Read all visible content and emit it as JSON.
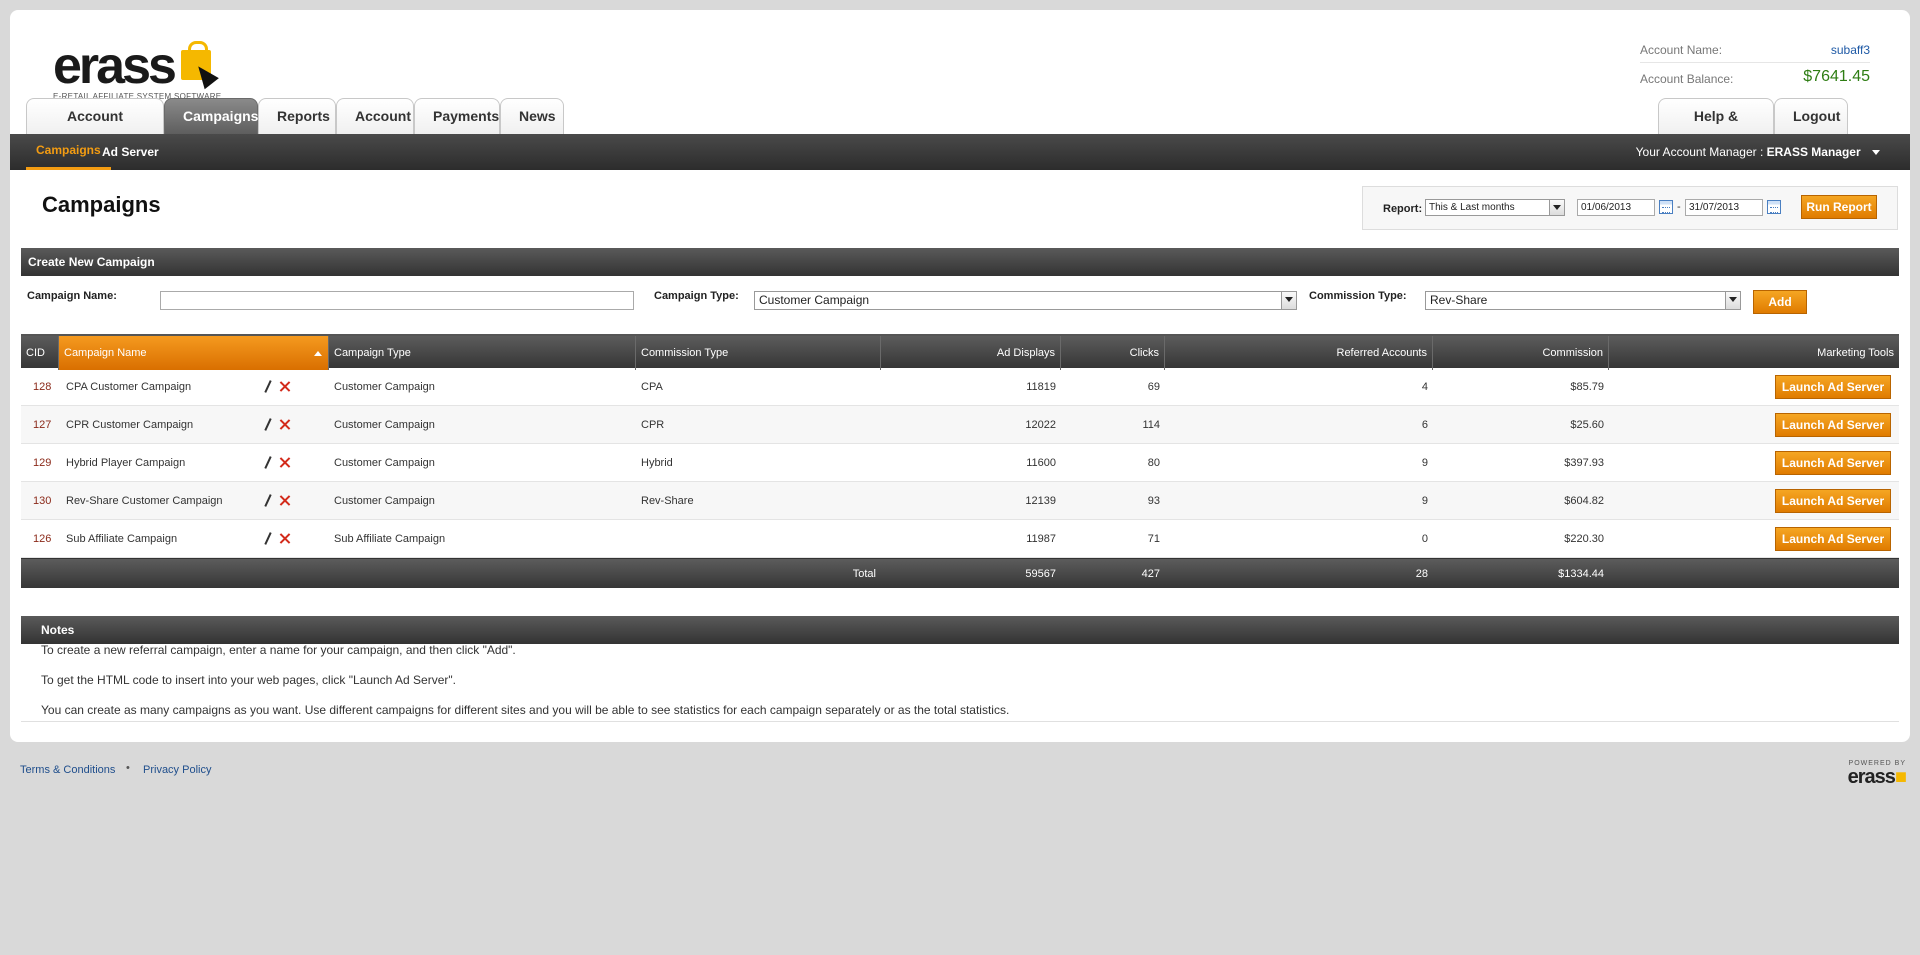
{
  "brand": {
    "logo_text": "erass",
    "tagline": "E-RETAIL AFFILIATE SYSTEM SOFTWARE"
  },
  "account": {
    "name_label": "Account Name:",
    "name_value": "subaff3",
    "balance_label": "Account Balance:",
    "balance_value": "$7641.45"
  },
  "tabs": [
    {
      "label": "Account Overview",
      "active": false
    },
    {
      "label": "Campaigns",
      "active": true
    },
    {
      "label": "Reports",
      "active": false
    },
    {
      "label": "Account",
      "active": false
    },
    {
      "label": "Payments",
      "active": false
    },
    {
      "label": "News",
      "active": false
    }
  ],
  "right_tabs": [
    {
      "label": "Help & Support"
    },
    {
      "label": "Logout"
    }
  ],
  "subnav": {
    "items": [
      {
        "label": "Campaigns",
        "active": true
      },
      {
        "label": "Ad Server",
        "active": false
      }
    ],
    "manager_label": "Your Account Manager :",
    "manager_name": "ERASS Manager"
  },
  "page_title": "Campaigns",
  "report": {
    "label": "Report:",
    "period": "This & Last months",
    "date_from": "01/06/2013",
    "separator": "-",
    "date_to": "31/07/2013",
    "run_label": "Run Report"
  },
  "create": {
    "header": "Create New Campaign",
    "name_label": "Campaign Name:",
    "name_value": "",
    "type_label": "Campaign Type:",
    "type_value": "Customer Campaign",
    "commission_label": "Commission Type:",
    "commission_value": "Rev-Share",
    "add_label": "Add"
  },
  "table": {
    "columns": [
      "CID",
      "Campaign Name",
      "Campaign Type",
      "Commission Type",
      "Ad Displays",
      "Clicks",
      "Referred Accounts",
      "Commission",
      "Marketing Tools"
    ],
    "rows": [
      {
        "cid": "128",
        "name": "CPA Customer Campaign",
        "type": "Customer Campaign",
        "commission_type": "CPA",
        "ad_displays": "11819",
        "clicks": "69",
        "referred": "4",
        "commission": "$85.79",
        "tool": "Launch Ad Server"
      },
      {
        "cid": "127",
        "name": "CPR Customer Campaign",
        "type": "Customer Campaign",
        "commission_type": "CPR",
        "ad_displays": "12022",
        "clicks": "114",
        "referred": "6",
        "commission": "$25.60",
        "tool": "Launch Ad Server"
      },
      {
        "cid": "129",
        "name": "Hybrid Player Campaign",
        "type": "Customer Campaign",
        "commission_type": "Hybrid",
        "ad_displays": "11600",
        "clicks": "80",
        "referred": "9",
        "commission": "$397.93",
        "tool": "Launch Ad Server"
      },
      {
        "cid": "130",
        "name": "Rev-Share Customer Campaign",
        "type": "Customer Campaign",
        "commission_type": "Rev-Share",
        "ad_displays": "12139",
        "clicks": "93",
        "referred": "9",
        "commission": "$604.82",
        "tool": "Launch Ad Server"
      },
      {
        "cid": "126",
        "name": "Sub Affiliate Campaign",
        "type": "Sub Affiliate Campaign",
        "commission_type": "",
        "ad_displays": "11987",
        "clicks": "71",
        "referred": "0",
        "commission": "$220.30",
        "tool": "Launch Ad Server"
      }
    ],
    "totals": {
      "label": "Total",
      "ad_displays": "59567",
      "clicks": "427",
      "referred": "28",
      "commission": "$1334.44"
    }
  },
  "notes": {
    "header": "Notes",
    "lines": [
      "To create a new referral campaign, enter a name for your campaign, and then click \"Add\".",
      "To get the HTML code to insert into your web pages, click \"Launch Ad Server\".",
      "You can create as many campaigns as you want. Use different campaigns for different sites and you will be able to see statistics for each campaign separately or as the total statistics."
    ]
  },
  "footer": {
    "terms": "Terms & Conditions",
    "bullet": "•",
    "privacy": "Privacy Policy",
    "powered_by": "POWERED BY",
    "powered_logo": "erass"
  },
  "colors": {
    "accent": "#f39c12",
    "dark_bar": "#333333",
    "balance": "#2e7d13",
    "link": "#1f4e8c"
  }
}
